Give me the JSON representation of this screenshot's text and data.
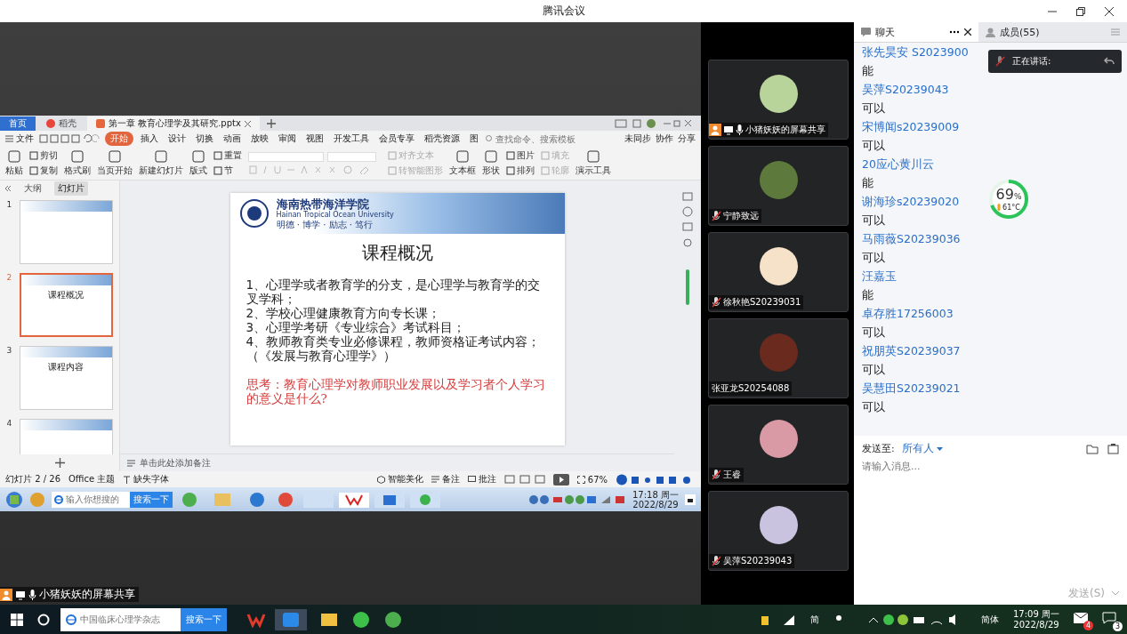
{
  "window": {
    "title": "腾讯会议"
  },
  "shared_screen": {
    "doc_tabs": [
      {
        "label": "首页",
        "kind": "home",
        "selected": false
      },
      {
        "label": "稻壳",
        "kind": "docer",
        "selected": false
      },
      {
        "label": "第一章 教育心理学及其研究.pptx",
        "kind": "doc",
        "selected": true
      }
    ],
    "menu": {
      "file": "文件",
      "tabs": [
        {
          "label": "开始",
          "selected": true
        },
        {
          "label": "插入",
          "selected": false
        },
        {
          "label": "设计",
          "selected": false
        },
        {
          "label": "切换",
          "selected": false
        },
        {
          "label": "动画",
          "selected": false
        },
        {
          "label": "放映",
          "selected": false
        },
        {
          "label": "审阅",
          "selected": false
        },
        {
          "label": "视图",
          "selected": false
        },
        {
          "label": "开发工具",
          "selected": false
        },
        {
          "label": "会员专享",
          "selected": false
        },
        {
          "label": "稻壳资源",
          "selected": false
        },
        {
          "label": "图",
          "selected": false
        }
      ],
      "search_placeholder": "查找命令、搜索模板",
      "actions": [
        "未同步",
        "协作",
        "分享"
      ]
    },
    "ribbon": [
      {
        "items": [
          {
            "label": "粘贴",
            "kind": "large",
            "disabled": false
          }
        ]
      },
      {
        "items": [
          {
            "label": "剪切",
            "kind": "small",
            "disabled": false
          },
          {
            "label": "复制",
            "kind": "small",
            "disabled": false
          }
        ]
      },
      {
        "items": [
          {
            "label": "格式刷",
            "kind": "large",
            "disabled": false
          }
        ]
      },
      {
        "items": [
          {
            "label": "当页开始",
            "kind": "large",
            "disabled": false
          }
        ]
      },
      {
        "items": [
          {
            "label": "新建幻灯片",
            "kind": "large",
            "disabled": false
          }
        ]
      },
      {
        "items": [
          {
            "label": "版式",
            "kind": "large",
            "disabled": false
          }
        ]
      },
      {
        "items": [
          {
            "label": "重置",
            "kind": "small",
            "disabled": false
          },
          {
            "label": "节",
            "kind": "small",
            "disabled": false
          }
        ]
      },
      {
        "items": [
          {
            "kind": "font"
          }
        ]
      },
      {
        "items": [
          {
            "label": "对齐文本",
            "kind": "small",
            "disabled": true
          },
          {
            "label": "转智能图形",
            "kind": "small",
            "disabled": true
          }
        ]
      },
      {
        "items": [
          {
            "label": "文本框",
            "kind": "large",
            "disabled": false
          }
        ]
      },
      {
        "items": [
          {
            "label": "形状",
            "kind": "large",
            "disabled": false
          }
        ]
      },
      {
        "items": [
          {
            "label": "图片",
            "kind": "small",
            "disabled": false
          },
          {
            "label": "排列",
            "kind": "small",
            "disabled": false
          }
        ]
      },
      {
        "items": [
          {
            "label": "填充",
            "kind": "small",
            "disabled": true
          },
          {
            "label": "轮廓",
            "kind": "small",
            "disabled": true
          }
        ]
      },
      {
        "items": [
          {
            "label": "演示工具",
            "kind": "large",
            "disabled": false
          }
        ]
      }
    ],
    "panel_tabs": [
      {
        "label": "大纲",
        "selected": false
      },
      {
        "label": "幻灯片",
        "selected": true
      }
    ],
    "thumbnails": [
      {
        "number": "1",
        "selected": false
      },
      {
        "number": "2",
        "title": "课程概况",
        "selected": true
      },
      {
        "number": "3",
        "title": "课程内容",
        "selected": false
      },
      {
        "number": "4",
        "selected": false
      }
    ],
    "slide": {
      "school_name": "海南热带海洋学院",
      "school_name_en": "Hainan Tropical Ocean University",
      "motto": "明德 · 博学 · 励志 · 笃行",
      "title": "课程概况",
      "points": [
        "1、心理学或者教育学的分支，是心理学与教育学的交叉学科；",
        "2、学校心理健康教育方向专长课；",
        "3、心理学考研《专业综合》考试科目；",
        "4、教师教育类专业必修课程，教师资格证考试内容；（《发展与教育心理学》）"
      ],
      "question": "思考：教育心理学对教师职业发展以及学习者个人学习的意义是什么?"
    },
    "notes_placeholder": "单击此处添加备注",
    "status": {
      "slide_count": "幻灯片 2 / 26",
      "theme": "Office 主题",
      "missing_font": "缺失字体",
      "beautify": "智能美化",
      "notes": "备注",
      "comment": "批注",
      "zoom": "67%"
    },
    "taskbar": {
      "search_placeholder": "输入你想搜的",
      "search_button": "搜索一下",
      "time": "17:18 周一",
      "date": "2022/8/29"
    }
  },
  "share_label": "小猪妖妖的屏幕共享",
  "participants": [
    {
      "name": "小猪妖妖的屏幕共享",
      "kind": "sharer",
      "color": "#b9d49a"
    },
    {
      "name": "宁静致远",
      "kind": "muted",
      "color": "#5d7a3c"
    },
    {
      "name": "徐秋艳S20239031",
      "kind": "muted",
      "color": "#f6e2c8"
    },
    {
      "name": "张亚龙S20254088",
      "kind": "plain",
      "color": "#6b2a1e"
    },
    {
      "name": "王睿",
      "kind": "muted",
      "color": "#d99aa5"
    },
    {
      "name": "吴萍S20239043",
      "kind": "muted",
      "color": "#c9c3e0"
    }
  ],
  "chat": {
    "tabs": [
      {
        "label": "聊天",
        "selected": true
      },
      {
        "label": "成员(55)",
        "selected": false
      }
    ],
    "messages": [
      {
        "sender": "张先昊安 S2023900",
        "text": "能"
      },
      {
        "sender": "吴萍S20239043",
        "text": "可以"
      },
      {
        "sender": "宋博闻s20239009",
        "text": "可以"
      },
      {
        "sender": "20应心黄川云",
        "text": "能"
      },
      {
        "sender": "谢海珍s20239020",
        "text": "可以"
      },
      {
        "sender": "马雨薇S20239036",
        "text": "可以"
      },
      {
        "sender": "汪嘉玉",
        "text": "能"
      },
      {
        "sender": "卓存胜17256003",
        "text": "可以"
      },
      {
        "sender": "祝朋英S20239037",
        "text": "可以"
      },
      {
        "sender": "吴慧田S20239021",
        "text": "可以"
      }
    ],
    "speaking": "正在讲话:",
    "monitor": {
      "percent": "69",
      "unit": "%",
      "temperature": "61°C",
      "level": 0.69
    },
    "send_to_label": "发送至:",
    "recipient": "所有人",
    "placeholder": "请输入消息...",
    "send": "发送(S)"
  },
  "taskbar": {
    "search_placeholder": "中国临床心理学杂志",
    "search_button": "搜索一下",
    "tray_ime": "简",
    "language": "简体",
    "time": "17:09 周一",
    "date": "2022/8/29",
    "mail_badge": "4",
    "notification_count": "3"
  }
}
